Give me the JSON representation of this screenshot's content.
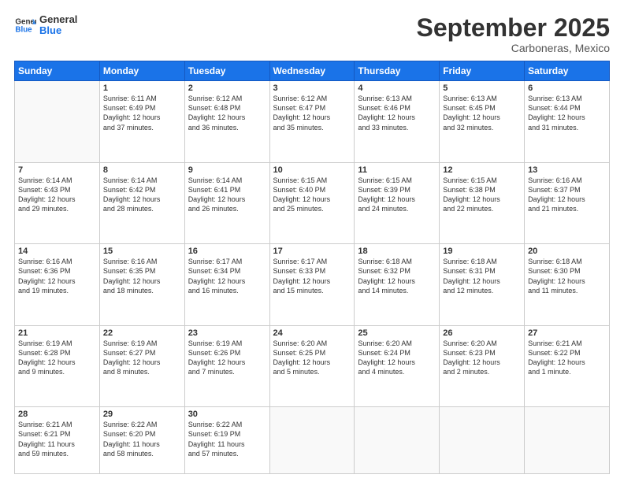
{
  "header": {
    "logo_general": "General",
    "logo_blue": "Blue",
    "month_title": "September 2025",
    "subtitle": "Carboneras, Mexico"
  },
  "days_of_week": [
    "Sunday",
    "Monday",
    "Tuesday",
    "Wednesday",
    "Thursday",
    "Friday",
    "Saturday"
  ],
  "weeks": [
    [
      {
        "day": "",
        "info": ""
      },
      {
        "day": "1",
        "info": "Sunrise: 6:11 AM\nSunset: 6:49 PM\nDaylight: 12 hours\nand 37 minutes."
      },
      {
        "day": "2",
        "info": "Sunrise: 6:12 AM\nSunset: 6:48 PM\nDaylight: 12 hours\nand 36 minutes."
      },
      {
        "day": "3",
        "info": "Sunrise: 6:12 AM\nSunset: 6:47 PM\nDaylight: 12 hours\nand 35 minutes."
      },
      {
        "day": "4",
        "info": "Sunrise: 6:13 AM\nSunset: 6:46 PM\nDaylight: 12 hours\nand 33 minutes."
      },
      {
        "day": "5",
        "info": "Sunrise: 6:13 AM\nSunset: 6:45 PM\nDaylight: 12 hours\nand 32 minutes."
      },
      {
        "day": "6",
        "info": "Sunrise: 6:13 AM\nSunset: 6:44 PM\nDaylight: 12 hours\nand 31 minutes."
      }
    ],
    [
      {
        "day": "7",
        "info": "Sunrise: 6:14 AM\nSunset: 6:43 PM\nDaylight: 12 hours\nand 29 minutes."
      },
      {
        "day": "8",
        "info": "Sunrise: 6:14 AM\nSunset: 6:42 PM\nDaylight: 12 hours\nand 28 minutes."
      },
      {
        "day": "9",
        "info": "Sunrise: 6:14 AM\nSunset: 6:41 PM\nDaylight: 12 hours\nand 26 minutes."
      },
      {
        "day": "10",
        "info": "Sunrise: 6:15 AM\nSunset: 6:40 PM\nDaylight: 12 hours\nand 25 minutes."
      },
      {
        "day": "11",
        "info": "Sunrise: 6:15 AM\nSunset: 6:39 PM\nDaylight: 12 hours\nand 24 minutes."
      },
      {
        "day": "12",
        "info": "Sunrise: 6:15 AM\nSunset: 6:38 PM\nDaylight: 12 hours\nand 22 minutes."
      },
      {
        "day": "13",
        "info": "Sunrise: 6:16 AM\nSunset: 6:37 PM\nDaylight: 12 hours\nand 21 minutes."
      }
    ],
    [
      {
        "day": "14",
        "info": "Sunrise: 6:16 AM\nSunset: 6:36 PM\nDaylight: 12 hours\nand 19 minutes."
      },
      {
        "day": "15",
        "info": "Sunrise: 6:16 AM\nSunset: 6:35 PM\nDaylight: 12 hours\nand 18 minutes."
      },
      {
        "day": "16",
        "info": "Sunrise: 6:17 AM\nSunset: 6:34 PM\nDaylight: 12 hours\nand 16 minutes."
      },
      {
        "day": "17",
        "info": "Sunrise: 6:17 AM\nSunset: 6:33 PM\nDaylight: 12 hours\nand 15 minutes."
      },
      {
        "day": "18",
        "info": "Sunrise: 6:18 AM\nSunset: 6:32 PM\nDaylight: 12 hours\nand 14 minutes."
      },
      {
        "day": "19",
        "info": "Sunrise: 6:18 AM\nSunset: 6:31 PM\nDaylight: 12 hours\nand 12 minutes."
      },
      {
        "day": "20",
        "info": "Sunrise: 6:18 AM\nSunset: 6:30 PM\nDaylight: 12 hours\nand 11 minutes."
      }
    ],
    [
      {
        "day": "21",
        "info": "Sunrise: 6:19 AM\nSunset: 6:28 PM\nDaylight: 12 hours\nand 9 minutes."
      },
      {
        "day": "22",
        "info": "Sunrise: 6:19 AM\nSunset: 6:27 PM\nDaylight: 12 hours\nand 8 minutes."
      },
      {
        "day": "23",
        "info": "Sunrise: 6:19 AM\nSunset: 6:26 PM\nDaylight: 12 hours\nand 7 minutes."
      },
      {
        "day": "24",
        "info": "Sunrise: 6:20 AM\nSunset: 6:25 PM\nDaylight: 12 hours\nand 5 minutes."
      },
      {
        "day": "25",
        "info": "Sunrise: 6:20 AM\nSunset: 6:24 PM\nDaylight: 12 hours\nand 4 minutes."
      },
      {
        "day": "26",
        "info": "Sunrise: 6:20 AM\nSunset: 6:23 PM\nDaylight: 12 hours\nand 2 minutes."
      },
      {
        "day": "27",
        "info": "Sunrise: 6:21 AM\nSunset: 6:22 PM\nDaylight: 12 hours\nand 1 minute."
      }
    ],
    [
      {
        "day": "28",
        "info": "Sunrise: 6:21 AM\nSunset: 6:21 PM\nDaylight: 11 hours\nand 59 minutes."
      },
      {
        "day": "29",
        "info": "Sunrise: 6:22 AM\nSunset: 6:20 PM\nDaylight: 11 hours\nand 58 minutes."
      },
      {
        "day": "30",
        "info": "Sunrise: 6:22 AM\nSunset: 6:19 PM\nDaylight: 11 hours\nand 57 minutes."
      },
      {
        "day": "",
        "info": ""
      },
      {
        "day": "",
        "info": ""
      },
      {
        "day": "",
        "info": ""
      },
      {
        "day": "",
        "info": ""
      }
    ]
  ]
}
